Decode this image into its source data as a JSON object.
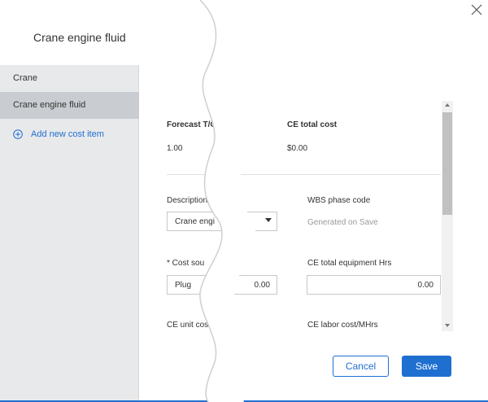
{
  "sidebar": {
    "title": "Crane engine fluid",
    "items": [
      {
        "label": "Crane"
      },
      {
        "label": "Crane engine fluid"
      }
    ],
    "add_label": "Add new cost item"
  },
  "summary": {
    "forecast_label": "Forecast T/O",
    "forecast_value": "1.00",
    "ce_total_cost_label": "CE total cost",
    "ce_total_cost_value": "$0.00"
  },
  "form": {
    "description_label": "Description",
    "description_value": "Crane engi",
    "wbs_label": "WBS phase code",
    "wbs_value": "Generated on Save",
    "cost_source_label": "* Cost sou",
    "cost_source_value": "Plug",
    "cost_source_amount": "0.00",
    "equipment_hrs_label": "CE total equipment Hrs",
    "equipment_hrs_value": "0.00",
    "unit_cost_label": "CE unit cost",
    "labor_cost_label": "CE labor cost/MHrs"
  },
  "actions": {
    "cancel_label": "Cancel",
    "save_label": "Save"
  },
  "icons": {
    "close": "close-icon",
    "add": "plus-circle-icon",
    "dropdown": "caret-down-icon"
  },
  "colors": {
    "accent": "#1f6fd1",
    "selected_bg": "#c9ccd0",
    "sidebar_bg": "#e8e9eb"
  }
}
